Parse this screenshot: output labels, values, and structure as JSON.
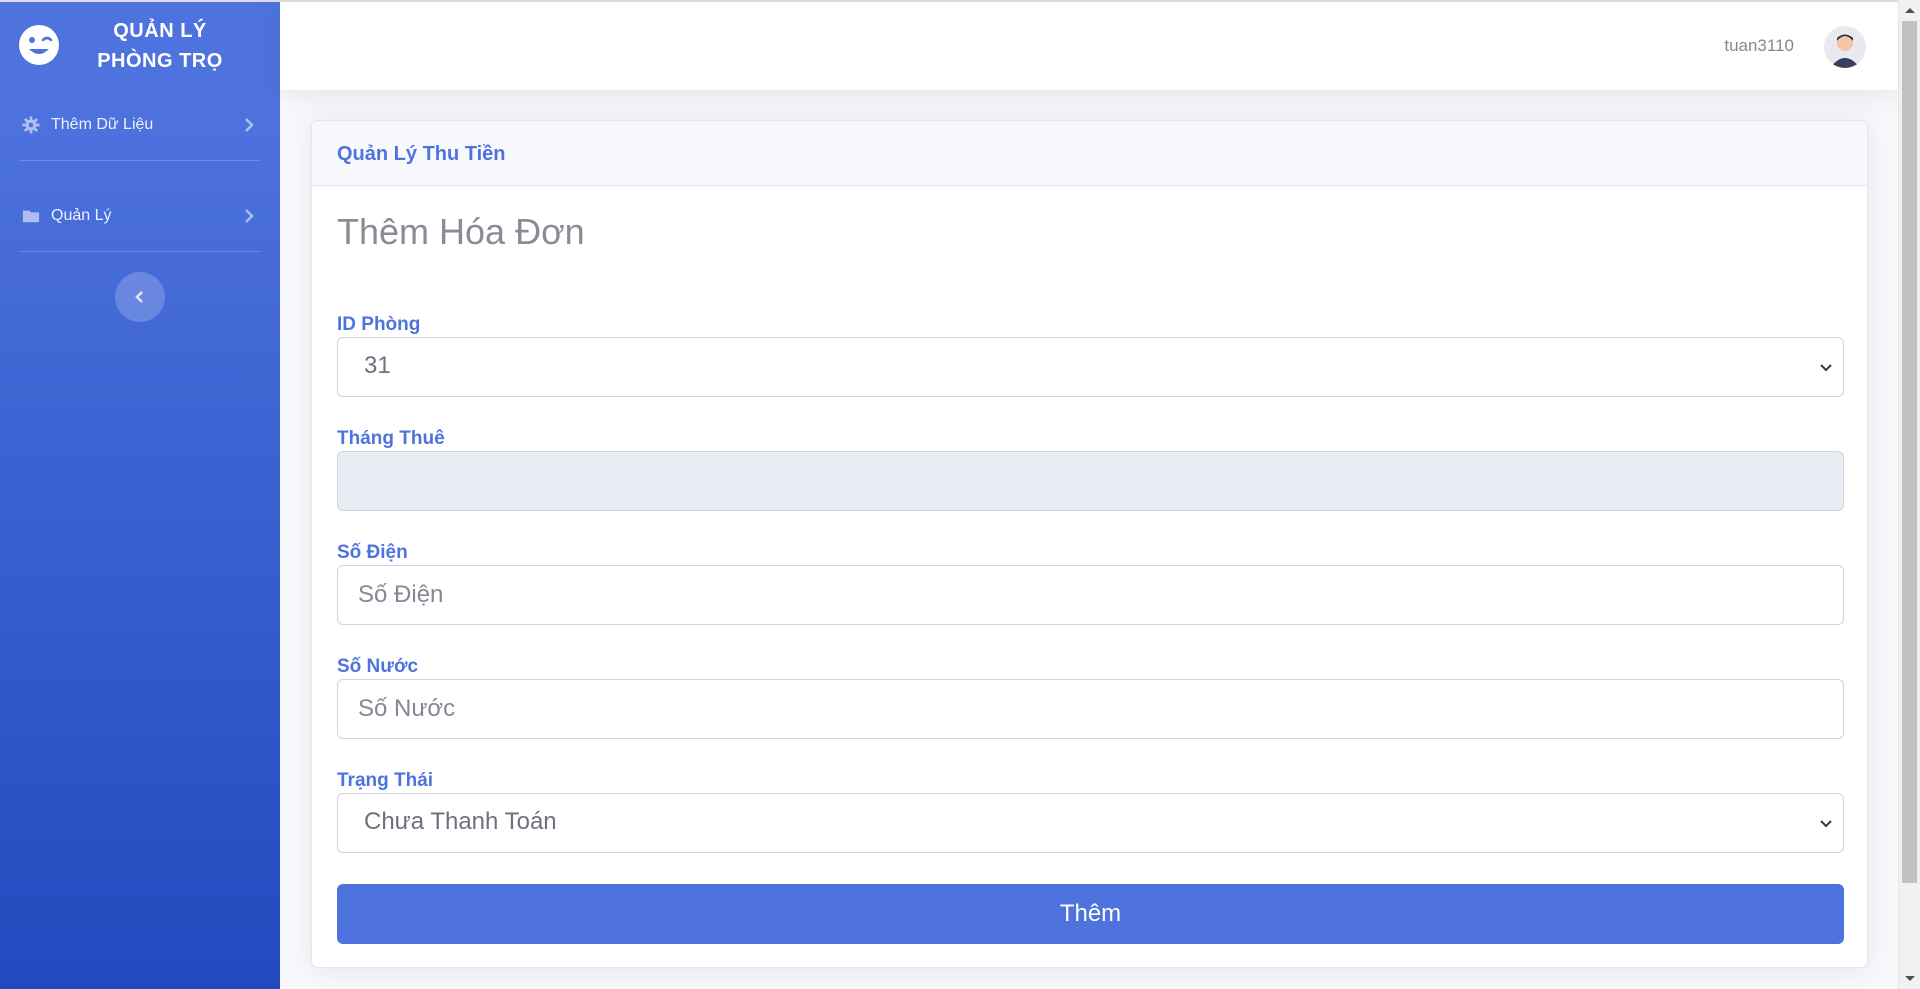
{
  "sidebar": {
    "brand": {
      "icon": "winking-face-icon",
      "line1": "QUẢN LÝ",
      "line2": "PHÒNG TRỌ"
    },
    "items": [
      {
        "label": "Thêm Dữ Liệu",
        "icon": "gear-icon"
      },
      {
        "label": "Quản Lý",
        "icon": "folder-icon"
      }
    ],
    "toggle_icon": "chevron-left-icon"
  },
  "topbar": {
    "username": "tuan3110",
    "avatar_icon": "user-avatar-icon"
  },
  "card": {
    "header": "Quản Lý Thu Tiền",
    "form_title": "Thêm Hóa Đơn",
    "fields": {
      "room": {
        "label": "ID Phòng",
        "value": "31"
      },
      "month": {
        "label": "Tháng Thuê",
        "value": ""
      },
      "electric": {
        "label": "Số Điện",
        "placeholder": "Số Điện"
      },
      "water": {
        "label": "Số Nước",
        "placeholder": "Số Nước"
      },
      "status": {
        "label": "Trạng Thái",
        "value": "Chưa Thanh Toán"
      }
    },
    "submit_label": "Thêm"
  },
  "colors": {
    "primary": "#4e73df",
    "sidebar_end": "#224abe",
    "muted_text": "#858796"
  }
}
